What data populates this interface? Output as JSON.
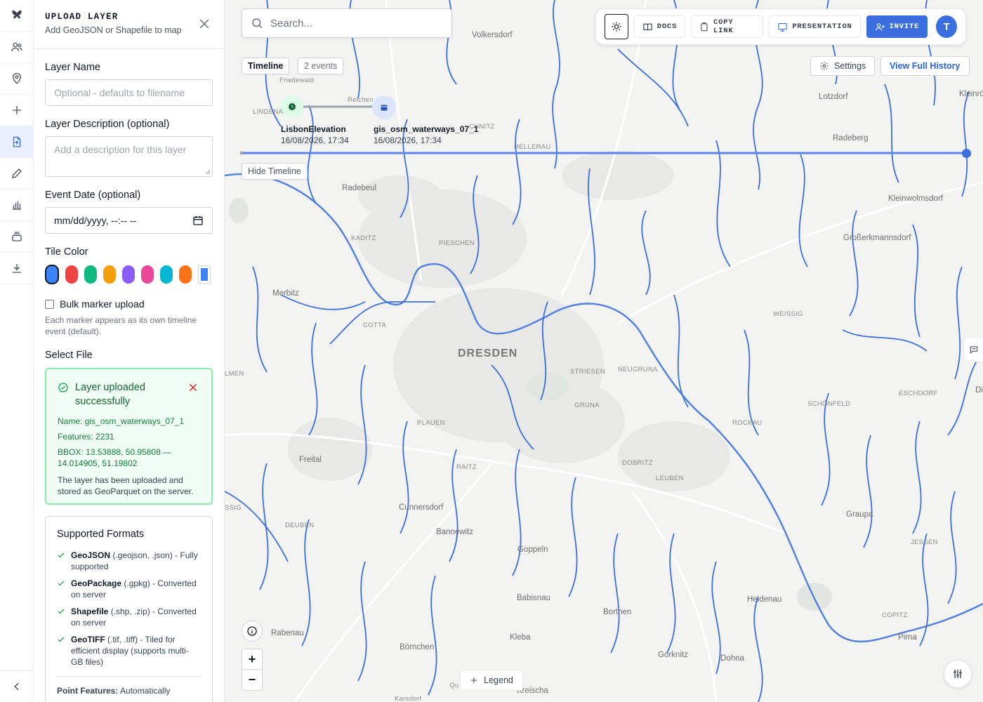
{
  "rail": {
    "items": [
      {
        "icon": "butterfly-logo-icon"
      },
      {
        "icon": "users-icon"
      },
      {
        "icon": "map-pin-icon"
      },
      {
        "icon": "plus-icon"
      },
      {
        "icon": "file-upload-icon",
        "active": true
      },
      {
        "icon": "pencil-icon"
      },
      {
        "icon": "bar-chart-icon"
      },
      {
        "icon": "layers-icon"
      },
      {
        "icon": "download-icon"
      }
    ],
    "collapse_icon": "chevron-left-icon"
  },
  "panel": {
    "title": "UPLOAD LAYER",
    "subtitle": "Add GeoJSON or Shapefile to map",
    "layer_name_label": "Layer Name",
    "layer_name_placeholder": "Optional - defaults to filename",
    "layer_desc_label": "Layer Description (optional)",
    "layer_desc_placeholder": "Add a description for this layer",
    "event_date_label": "Event Date (optional)",
    "event_date_value": "mm/dd/yyyy, --:-- --",
    "tile_color_label": "Tile Color",
    "tile_colors": [
      "#3b82f6",
      "#ef4444",
      "#10b981",
      "#f59e0b",
      "#8b5cf6",
      "#ec4899",
      "#06b6d4",
      "#f97316"
    ],
    "tile_color_selected": "#3b82f6",
    "bulk_label": "Bulk marker upload",
    "bulk_hint": "Each marker appears as its own timeline event (default).",
    "select_file_label": "Select File",
    "success": {
      "title": "Layer uploaded successfully",
      "name": "Name: gis_osm_waterways_07_1",
      "features": "Features: 2231",
      "bbox": "BBOX: 13.53888, 50.95808 — 14.014905, 51.19802",
      "note": "The layer has been uploaded and stored as GeoParquet on the server."
    },
    "formats": {
      "title": "Supported Formats",
      "items": [
        {
          "name": "GeoJSON",
          "detail": " (.geojson, .json) - Fully supported"
        },
        {
          "name": "GeoPackage",
          "detail": " (.gpkg) - Converted on server"
        },
        {
          "name": "Shapefile",
          "detail": " (.shp, .zip) - Converted on server"
        },
        {
          "name": "GeoTIFF",
          "detail": " (.tif, .tiff) - Tiled for efficient display (supports multi-GB files)"
        }
      ],
      "point_label": "Point Features:",
      "point_text": " Automatically"
    }
  },
  "map": {
    "search_placeholder": "Search...",
    "toolbar": {
      "docs": "DOCS",
      "copy_link": "COPY LINK",
      "presentation": "PRESENTATION",
      "invite": "INVITE",
      "avatar_initial": "T"
    },
    "timeline": {
      "tab": "Timeline",
      "count": "2 events",
      "settings": "Settings",
      "view_history": "View Full History",
      "hide": "Hide Timeline",
      "events": [
        {
          "name": "LisbonElevation",
          "time": "16/08/2026, 17:34",
          "color": "#22c55e"
        },
        {
          "name": "gis_osm_waterways_07_1",
          "time": "16/08/2026, 17:34",
          "color": "#3b6fe0"
        }
      ]
    },
    "legend": "Legend",
    "zoom_in": "+",
    "zoom_out": "−",
    "places": [
      {
        "t": "Volkersdorf",
        "k": "town"
      },
      {
        "t": "Friedewald",
        "k": "small"
      },
      {
        "t": "LINDENA",
        "k": "small"
      },
      {
        "t": "Reichen",
        "k": "small"
      },
      {
        "t": "CHNITZ",
        "k": "small"
      },
      {
        "t": "HELLERAU",
        "k": "small"
      },
      {
        "t": "Lotzdorf",
        "k": "town"
      },
      {
        "t": "Radeberg",
        "k": "town"
      },
      {
        "t": "Kleinröhrs",
        "k": "town"
      },
      {
        "t": "Radebeul",
        "k": "town"
      },
      {
        "t": "Kleinwolmsdorf",
        "k": "town"
      },
      {
        "t": "KADITZ",
        "k": "small"
      },
      {
        "t": "PIESCHEN",
        "k": "small"
      },
      {
        "t": "Großerkmannsdorf",
        "k": "town"
      },
      {
        "t": "Merbitz",
        "k": "town"
      },
      {
        "t": "COTTA",
        "k": "small"
      },
      {
        "t": "WEISSIG",
        "k": "small"
      },
      {
        "t": "DRESDEN",
        "k": "city"
      },
      {
        "t": "STRIESEN",
        "k": "small"
      },
      {
        "t": "NEUGRUNA",
        "k": "small"
      },
      {
        "t": "LMEN",
        "k": "small"
      },
      {
        "t": "GRUNA",
        "k": "small"
      },
      {
        "t": "SCHÖNFELD",
        "k": "small"
      },
      {
        "t": "ESCHDORF",
        "k": "small"
      },
      {
        "t": "Dit",
        "k": "town"
      },
      {
        "t": "PLAUEN",
        "k": "small"
      },
      {
        "t": "ROCKAU",
        "k": "small"
      },
      {
        "t": "Freital",
        "k": "town"
      },
      {
        "t": "RAITZ",
        "k": "small"
      },
      {
        "t": "DOBRITZ",
        "k": "small"
      },
      {
        "t": "LEUBEN",
        "k": "small"
      },
      {
        "t": "SSIG",
        "k": "small"
      },
      {
        "t": "Cunnersdorf",
        "k": "town"
      },
      {
        "t": "Graupa",
        "k": "town"
      },
      {
        "t": "DEUBEN",
        "k": "small"
      },
      {
        "t": "Bannewitz",
        "k": "town"
      },
      {
        "t": "JESSEN",
        "k": "small"
      },
      {
        "t": "Goppeln",
        "k": "town"
      },
      {
        "t": "Babisnau",
        "k": "town"
      },
      {
        "t": "Heidenau",
        "k": "town"
      },
      {
        "t": "Borthen",
        "k": "town"
      },
      {
        "t": "COPITZ",
        "k": "small"
      },
      {
        "t": "Rabenau",
        "k": "town"
      },
      {
        "t": "Pirna",
        "k": "town"
      },
      {
        "t": "Kleba",
        "k": "town"
      },
      {
        "t": "Börnchen",
        "k": "town"
      },
      {
        "t": "Gorknitz",
        "k": "town"
      },
      {
        "t": "Dohna",
        "k": "town"
      },
      {
        "t": "Kreischa",
        "k": "town"
      },
      {
        "t": "Karsdorf",
        "k": "small"
      },
      {
        "t": "Qu",
        "k": "small"
      }
    ]
  }
}
